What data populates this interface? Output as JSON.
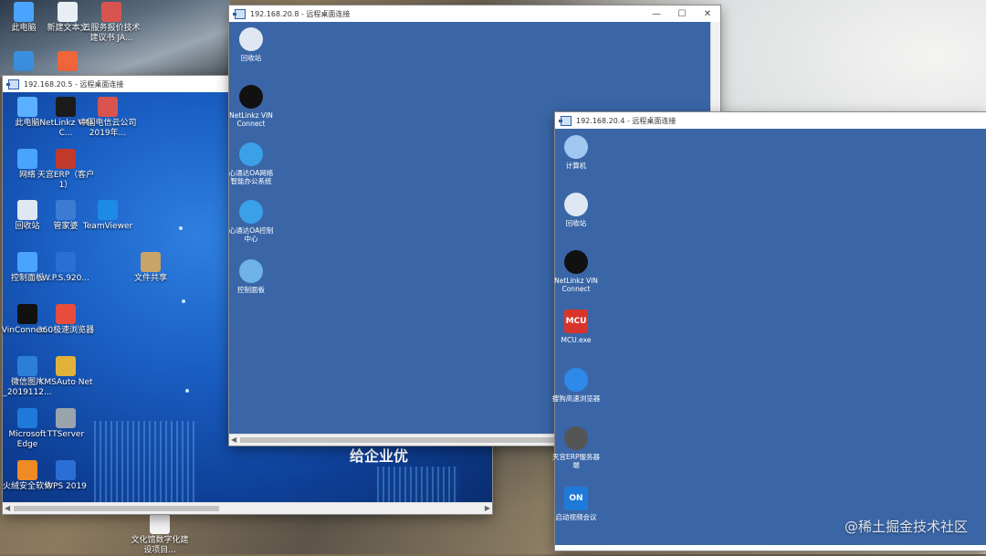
{
  "host_desktop": {
    "icons": [
      {
        "label": "此电脑",
        "color": "#4aa3ff"
      },
      {
        "label": "新建文本文",
        "color": "#e9eef4"
      },
      {
        "label": "云服务报价技术建议书 JA...",
        "color": "#d9534f"
      },
      {
        "label": "",
        "color": "#3b8fe0"
      },
      {
        "label": "",
        "color": "#f0663a"
      },
      {
        "label": "文化馆数字化建设项目...",
        "color": "#f4f4f4"
      }
    ],
    "watermark": "@稀土掘金技术社区"
  },
  "window1": {
    "title": "192.168.20.5 - 远程桌面连接",
    "icons": [
      {
        "label": "此电脑",
        "color": "#5ab0ff"
      },
      {
        "label": "NetLinkz VIN C...",
        "color": "#1b1b1b"
      },
      {
        "label": "中国电信云公司2019年...",
        "color": "#d9534f"
      },
      {
        "label": "网络",
        "color": "#4aa3ff"
      },
      {
        "label": "天宫ERP（客户1）",
        "color": "#c0392b"
      },
      {
        "label": "回收站",
        "color": "#dfe8f2"
      },
      {
        "label": "管家婆",
        "color": "#3b7bd4"
      },
      {
        "label": "TeamViewer",
        "color": "#1d8ae6"
      },
      {
        "label": "控制面板",
        "color": "#4aa3ff"
      },
      {
        "label": "W.P.S.920...",
        "color": "#2a6fd6"
      },
      {
        "label": "文件共享",
        "color": "#c8a468"
      },
      {
        "label": "VinConnec...",
        "color": "#111111"
      },
      {
        "label": "360极速浏览器",
        "color": "#e74c3c"
      },
      {
        "label": "微信图片_2019112...",
        "color": "#2b7fd8"
      },
      {
        "label": "KMSAuto Net",
        "color": "#e0b23a"
      },
      {
        "label": "Microsoft Edge",
        "color": "#1e7ad8"
      },
      {
        "label": "TTServer",
        "color": "#9aa4ad"
      },
      {
        "label": "火绒安全软件",
        "color": "#f08a24"
      },
      {
        "label": "WPS 2019",
        "color": "#2a6fd6"
      }
    ],
    "banner": "给企业优"
  },
  "window2": {
    "title": "192.168.20.8 - 远程桌面连接",
    "icons": [
      {
        "label": "回收站",
        "color": "#dfe8f2"
      },
      {
        "label": "NetLinkz VIN Connect",
        "color": "#111111"
      },
      {
        "label": "心通达OA网络智能办公系统",
        "color": "#3aa0e8"
      },
      {
        "label": "心通达OA控制中心",
        "color": "#3aa0e8"
      },
      {
        "label": "控制面板",
        "color": "#6fb3e8"
      }
    ]
  },
  "window3": {
    "title": "192.168.20.4 - 远程桌面连接",
    "icons": [
      {
        "label": "计算机",
        "color": "#9fc7ef"
      },
      {
        "label": "回收站",
        "color": "#dfe8f2"
      },
      {
        "label": "NetLinkz VIN Connect",
        "color": "#111111"
      },
      {
        "label": "MCU.exe",
        "color": "#d9342b",
        "text": "MCU"
      },
      {
        "label": "搜狗高速浏览器",
        "color": "#2d8ae8"
      },
      {
        "label": "天宫ERP服务器端",
        "color": "#555555"
      },
      {
        "label": "启动视频会议",
        "color": "#1e7ad8",
        "text": "ON"
      }
    ]
  },
  "window_controls": {
    "minimize": "—",
    "maximize": "☐",
    "close": "✕"
  }
}
